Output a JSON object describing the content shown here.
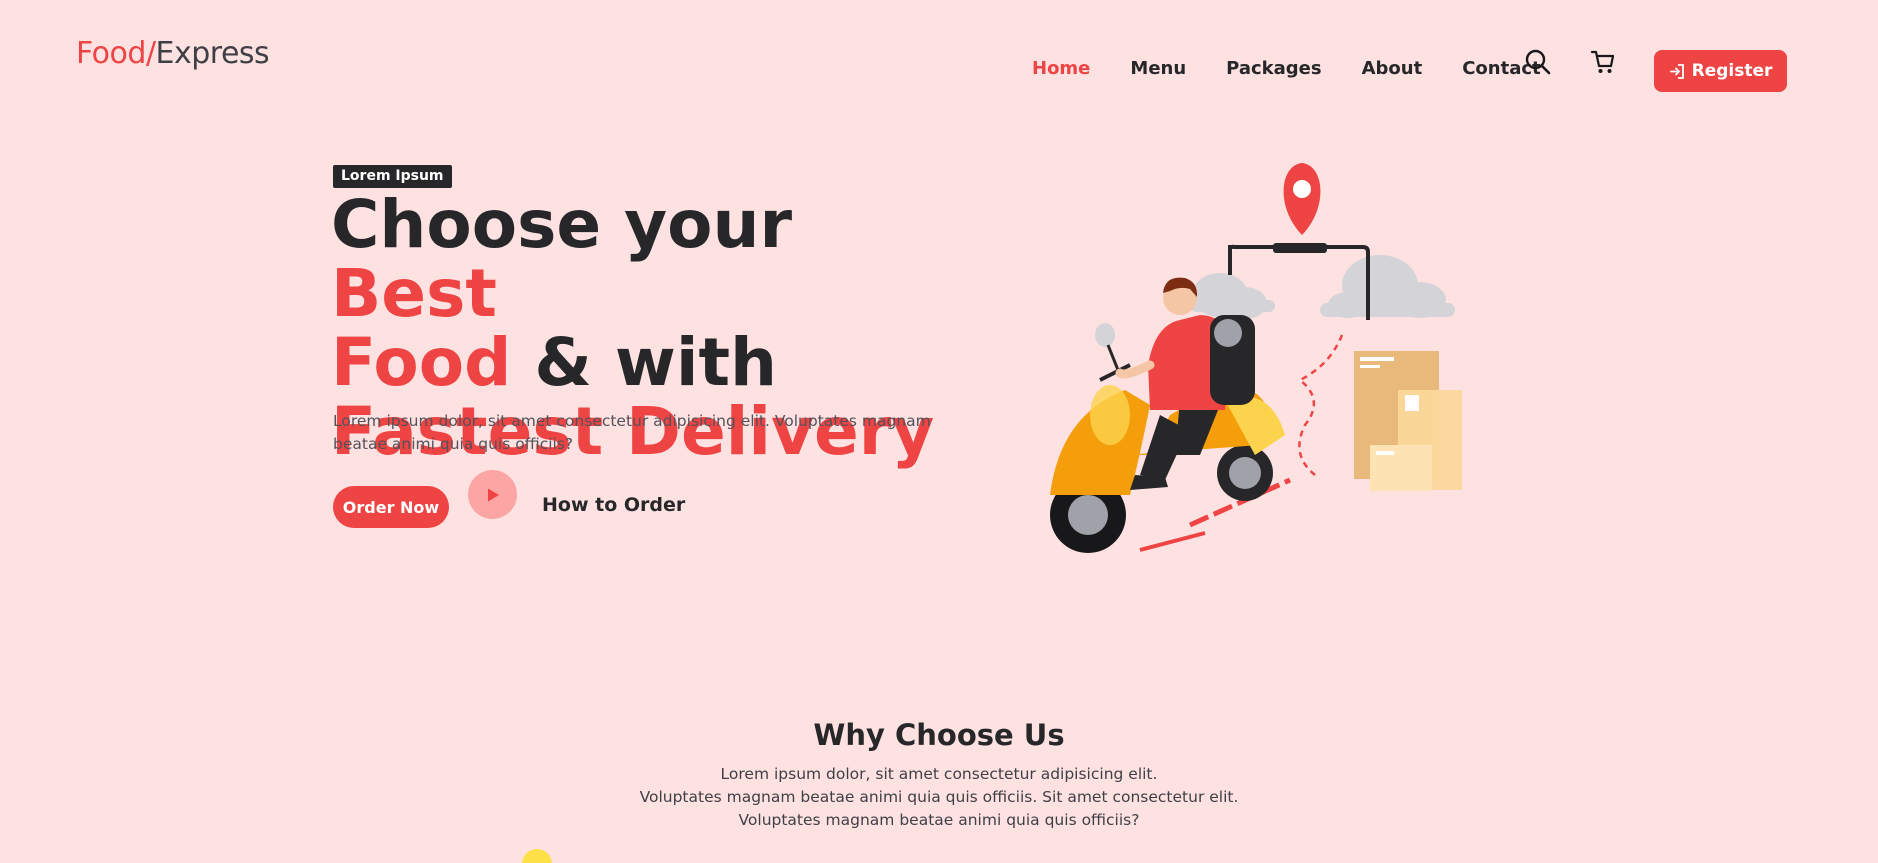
{
  "logo": {
    "part1": "Food/",
    "part2": "Express"
  },
  "nav": {
    "items": [
      {
        "label": "Home",
        "active": true
      },
      {
        "label": "Menu"
      },
      {
        "label": "Packages"
      },
      {
        "label": "About"
      },
      {
        "label": "Contact"
      }
    ],
    "register_label": "Register",
    "icons": [
      "search-icon",
      "cart-icon",
      "login-icon"
    ]
  },
  "hero": {
    "badge": "Lorem Ipsum",
    "title_line1_a": "Choose your ",
    "title_line1_b": "Best",
    "title_line2_a": "Food",
    "title_line2_b": " & with",
    "title_line3": "Fastest Delivery",
    "description": "Lorem ipsum dolor, sit amet consectetur adipisicing elit. Voluptates magnam beatae animi quia quis officiis?",
    "order_button": "Order Now",
    "how_to_order": "How to Order"
  },
  "why": {
    "title": "Why Choose Us",
    "line1": "Lorem ipsum dolor, sit amet consectetur adipisicing elit.",
    "line2": "Voluptates magnam beatae animi quia quis officiis. Sit amet consectetur elit.",
    "line3": "Voluptates magnam beatae animi quia quis officiis?"
  },
  "colors": {
    "background": "#fee2e2",
    "accent": "#ef4444",
    "dark": "#27272a"
  }
}
